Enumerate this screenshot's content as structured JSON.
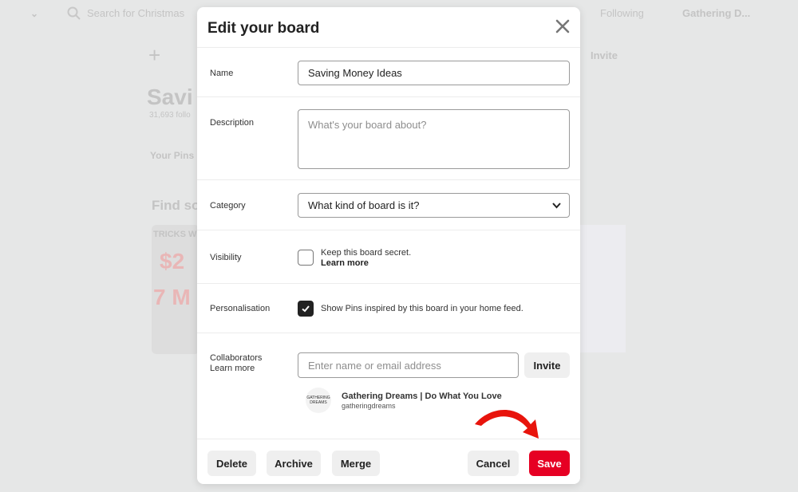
{
  "background": {
    "search_placeholder": "Search for Christmas",
    "following": "Following",
    "account": "Gathering D...",
    "invite": "Invite",
    "board_title": "Savi",
    "followers": "31,693 follo",
    "your_pins": "Your Pins",
    "find_some": "Find so",
    "pin_text": "TRICKS WI"
  },
  "modal": {
    "title": "Edit your board",
    "name": {
      "label": "Name",
      "value": "Saving Money Ideas"
    },
    "description": {
      "label": "Description",
      "placeholder": "What's your board about?"
    },
    "category": {
      "label": "Category",
      "value": "What kind of board is it?"
    },
    "visibility": {
      "label": "Visibility",
      "text": "Keep this board secret.",
      "link": "Learn more",
      "checked": false
    },
    "personalisation": {
      "label": "Personalisation",
      "text": "Show Pins inspired by this board in your home feed.",
      "checked": true
    },
    "collaborators": {
      "label": "Collaborators",
      "link": "Learn more",
      "placeholder": "Enter name or email address",
      "invite": "Invite",
      "owner": {
        "name": "Gathering Dreams | Do What You Love",
        "username": "gatheringdreams",
        "avatar_text": "GATHERING DREAMS"
      }
    },
    "buttons": {
      "delete": "Delete",
      "archive": "Archive",
      "merge": "Merge",
      "cancel": "Cancel",
      "save": "Save"
    },
    "colors": {
      "save": "#e60023",
      "arrow": "#e8140c"
    }
  }
}
